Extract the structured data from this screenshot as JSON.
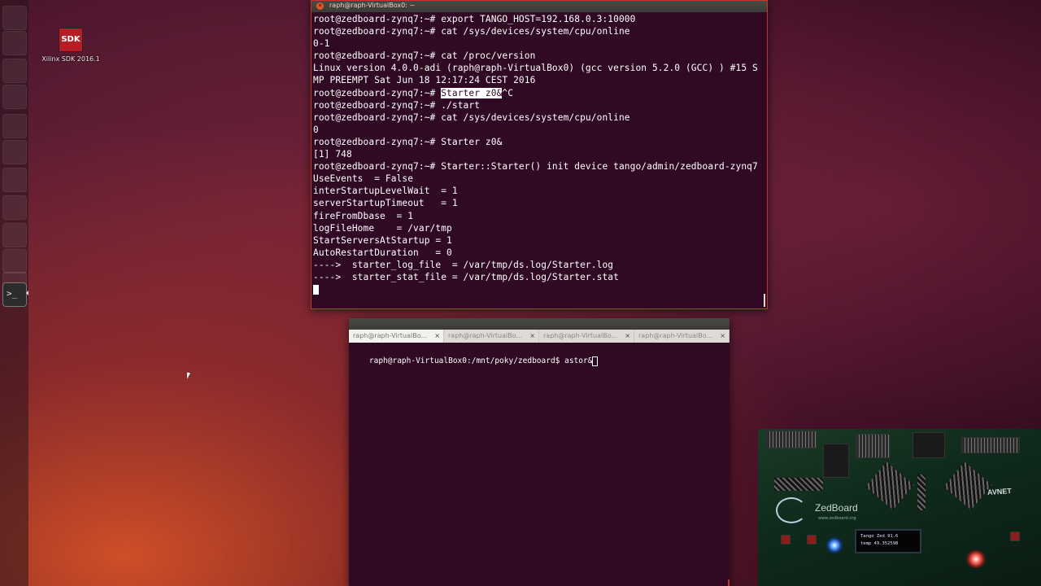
{
  "desktop": {
    "icon_badge": "SDK",
    "icon_label": "Xilinx SDK 2016.1"
  },
  "launcher": {
    "items": [
      "dash-icon",
      "files-icon",
      "firefox-icon",
      "libreoffice-writer-icon",
      "libreoffice-calc-icon",
      "libreoffice-impress-icon",
      "software-center-icon",
      "sdk-icon",
      "settings-icon",
      "virtualbox-icon",
      "system-settings-icon",
      "terminal-icon"
    ],
    "active": "terminal-icon"
  },
  "terminal1": {
    "title": "raph@raph-VirtualBox0: ~",
    "lines": [
      {
        "pre": "root@zedboard-zynq7:~# export TANGO_HOST=192.168.0.3:10000",
        "hl": "",
        "post": ""
      },
      {
        "pre": "root@zedboard-zynq7:~# cat /sys/devices/system/cpu/online",
        "hl": "",
        "post": ""
      },
      {
        "pre": "0-1",
        "hl": "",
        "post": ""
      },
      {
        "pre": "root@zedboard-zynq7:~# cat /proc/version",
        "hl": "",
        "post": ""
      },
      {
        "pre": "Linux version 4.0.0-adi (raph@raph-VirtualBox0) (gcc version 5.2.0 (GCC) ) #15 S",
        "hl": "",
        "post": ""
      },
      {
        "pre": "MP PREEMPT Sat Jun 18 12:17:24 CEST 2016",
        "hl": "",
        "post": ""
      },
      {
        "pre": "root@zedboard-zynq7:~# ",
        "hl": "Starter z0&",
        "post": "^C"
      },
      {
        "pre": "root@zedboard-zynq7:~# ./start",
        "hl": "",
        "post": ""
      },
      {
        "pre": "root@zedboard-zynq7:~# cat /sys/devices/system/cpu/online",
        "hl": "",
        "post": ""
      },
      {
        "pre": "0",
        "hl": "",
        "post": ""
      },
      {
        "pre": "root@zedboard-zynq7:~# Starter z0&",
        "hl": "",
        "post": ""
      },
      {
        "pre": "[1] 748",
        "hl": "",
        "post": ""
      },
      {
        "pre": "root@zedboard-zynq7:~# Starter::Starter() init device tango/admin/zedboard-zynq7",
        "hl": "",
        "post": ""
      },
      {
        "pre": "UseEvents  = False",
        "hl": "",
        "post": ""
      },
      {
        "pre": "interStartupLevelWait  = 1",
        "hl": "",
        "post": ""
      },
      {
        "pre": "serverStartupTimeout   = 1",
        "hl": "",
        "post": ""
      },
      {
        "pre": "fireFromDbase  = 1",
        "hl": "",
        "post": ""
      },
      {
        "pre": "logFileHome    = /var/tmp",
        "hl": "",
        "post": ""
      },
      {
        "pre": "StartServersAtStartup = 1",
        "hl": "",
        "post": ""
      },
      {
        "pre": "AutoRestartDuration   = 0",
        "hl": "",
        "post": ""
      },
      {
        "pre": "---->  starter_log_file  = /var/tmp/ds.log/Starter.log",
        "hl": "",
        "post": ""
      },
      {
        "pre": "---->  starter_stat_file = /var/tmp/ds.log/Starter.stat",
        "hl": "",
        "post": ""
      }
    ]
  },
  "terminal2": {
    "tabs": [
      {
        "label": "raph@raph-VirtualBo...",
        "close": "×"
      },
      {
        "label": "raph@raph-VirtualBo...",
        "close": "×"
      },
      {
        "label": "raph@raph-VirtualBo...",
        "close": "×"
      },
      {
        "label": "raph@raph-VirtualBo...",
        "close": "×"
      }
    ],
    "prompt": "raph@raph-VirtualBox0:/mnt/poky/zedboard$ astor&"
  },
  "webcam": {
    "brand": "ZedBoard",
    "url": "www.zedboard.org",
    "vendor": "AVNET",
    "oled_line1": "Tango Zed 91.6",
    "oled_line2": "temp 49.352598"
  },
  "colors": {
    "terminal_bg": "#300a24",
    "close_button": "#e25a2b",
    "window_border": "#c0392b"
  }
}
